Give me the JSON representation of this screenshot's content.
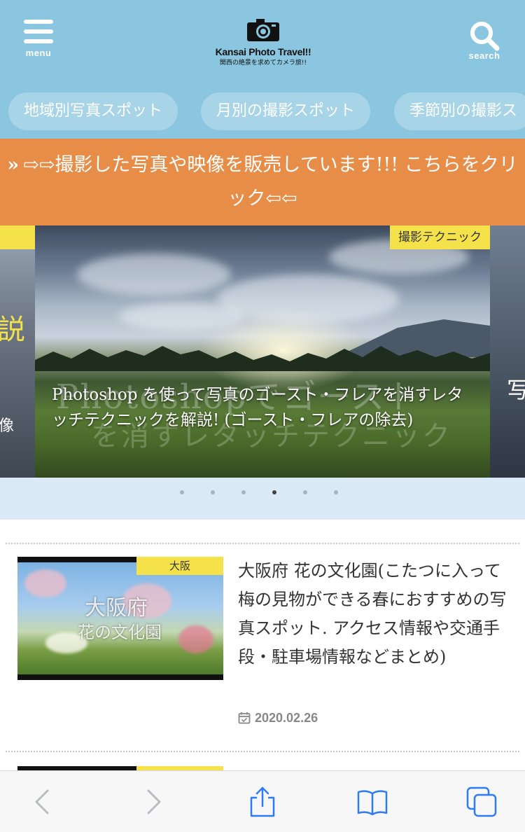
{
  "header": {
    "menu_label": "menu",
    "search_label": "search",
    "logo_title": "Kansai Photo Travel!!",
    "logo_subtitle": "関西の絶景を求めてカメラ旅!!"
  },
  "nav": {
    "pills": [
      "地域別写真スポット",
      "月別の撮影スポット",
      "季節別の撮影ス"
    ]
  },
  "promo": {
    "chevron": "»",
    "text": "⇨⇨撮影した写真や映像を販売しています!!! こちらをクリック⇦⇦"
  },
  "carousel": {
    "left_peek_text": "説",
    "left_peek_caption": "像",
    "right_peek_caption": "写",
    "main": {
      "tag": "撮影テクニック",
      "overlay_line1": "Photoshopでゴースト",
      "overlay_line2": "を消すレタッチテクニック",
      "title": "Photoshop を使って写真のゴースト・フレアを消すレタッチテクニックを解説! (ゴースト・フレアの除去)"
    },
    "dot_count": 6,
    "active_dot": 3
  },
  "articles": [
    {
      "tag": "大阪",
      "thumb_text_1": "大阪府",
      "thumb_text_2": "花の文化園",
      "title": "大阪府 花の文化園(こたつに入って梅の見物ができる春におすすめの写真スポット. アクセス情報や交通手段・駐車場情報などまとめ)",
      "date": "2020.02.26"
    }
  ],
  "toolbar": {
    "icons": [
      "back-icon",
      "forward-icon",
      "share-icon",
      "bookmarks-icon",
      "tabs-icon"
    ],
    "accent": "#2e7bf6"
  }
}
